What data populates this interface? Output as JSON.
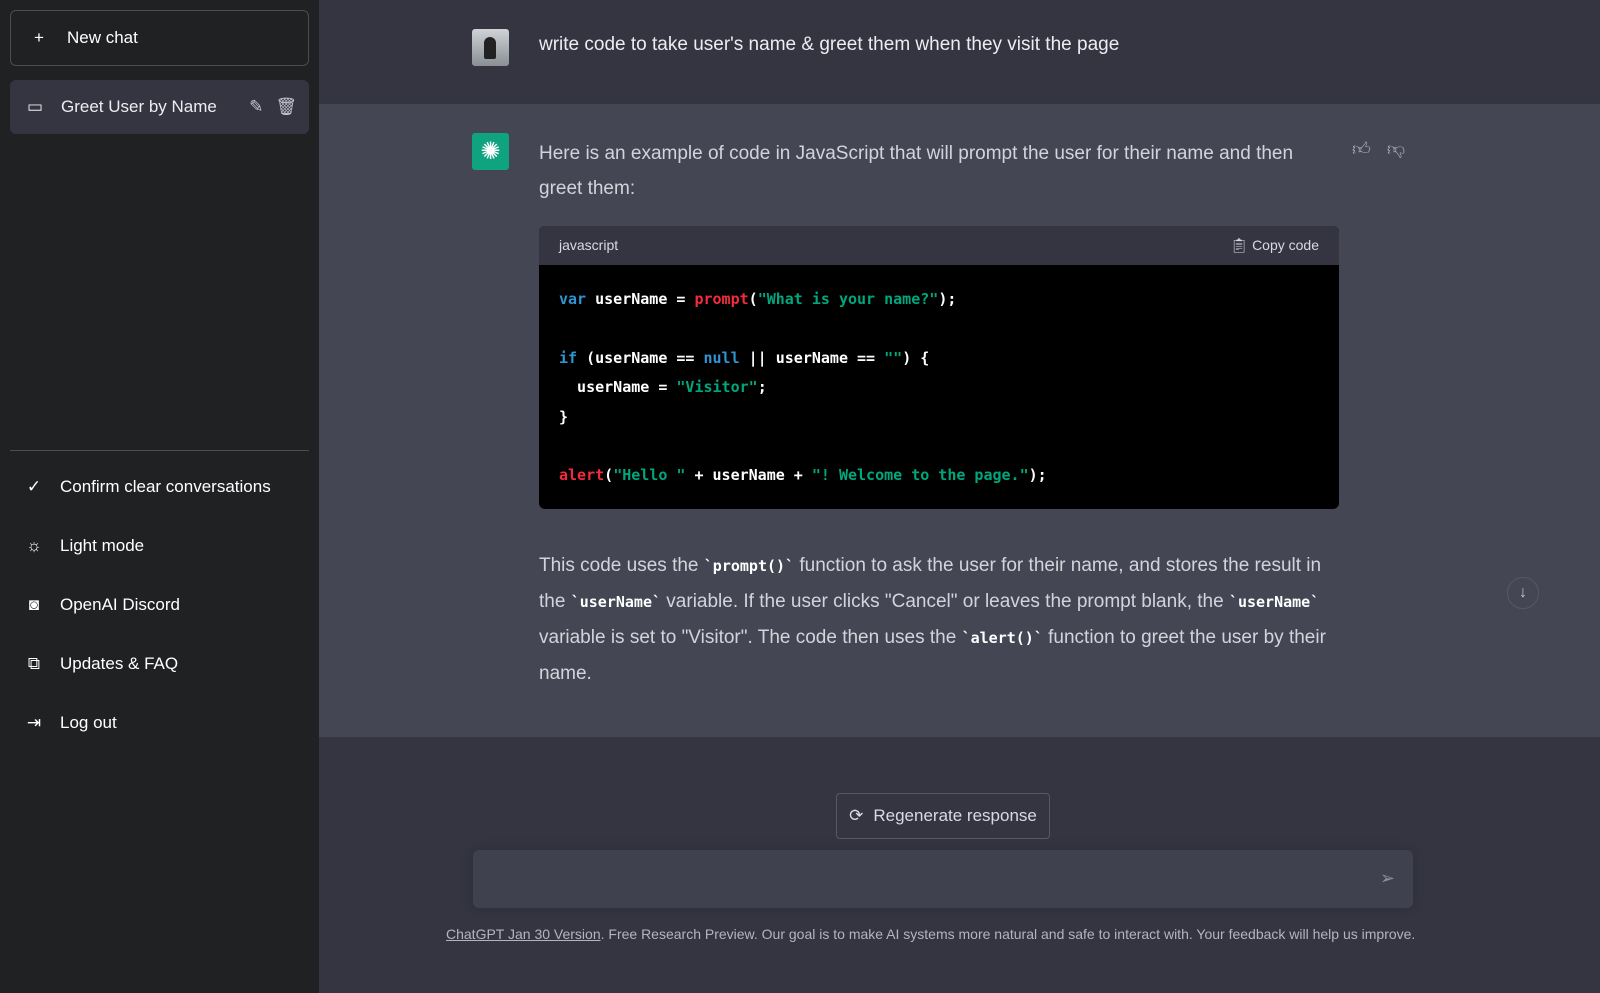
{
  "sidebar": {
    "new_chat": "New chat",
    "conversation": "Greet User by Name",
    "items": [
      {
        "label": "Confirm clear conversations",
        "icon": "check-icon"
      },
      {
        "label": "Light mode",
        "icon": "sun-icon"
      },
      {
        "label": "OpenAI Discord",
        "icon": "discord-icon"
      },
      {
        "label": "Updates & FAQ",
        "icon": "external-link-icon"
      },
      {
        "label": "Log out",
        "icon": "logout-icon"
      }
    ]
  },
  "chat": {
    "user_message": "write code to take user's name & greet them when they visit the page",
    "intro": "Here is an example of code in JavaScript that will prompt the user for their name and then greet them:",
    "code_lang": "javascript",
    "copy_label": "Copy code",
    "code_lines": [
      [
        [
          "kw",
          "var"
        ],
        [
          "p",
          " userName = "
        ],
        [
          "fn",
          "prompt"
        ],
        [
          "p",
          "("
        ],
        [
          "str",
          "\"What is your name?\""
        ],
        [
          "p",
          ");"
        ]
      ],
      [],
      [
        [
          "kw",
          "if"
        ],
        [
          "p",
          " (userName == "
        ],
        [
          "kw",
          "null"
        ],
        [
          "p",
          " || userName == "
        ],
        [
          "str",
          "\"\""
        ],
        [
          "p",
          ") {"
        ]
      ],
      [
        [
          "p",
          "  userName = "
        ],
        [
          "str",
          "\"Visitor\""
        ],
        [
          "p",
          ";"
        ]
      ],
      [
        [
          "p",
          "}"
        ]
      ],
      [],
      [
        [
          "fn",
          "alert"
        ],
        [
          "p",
          "("
        ],
        [
          "str",
          "\"Hello \""
        ],
        [
          "p",
          " + userName + "
        ],
        [
          "str",
          "\"! Welcome to the page.\""
        ],
        [
          "p",
          ");"
        ]
      ]
    ],
    "explain": {
      "t1": "This code uses the ",
      "c1": "`prompt()`",
      "t2": " function to ask the user for their name, and stores the result in the ",
      "c2": "`userName`",
      "t3": " variable. If the user clicks \"Cancel\" or leaves the prompt blank, the ",
      "c3": "`userName`",
      "t4": " variable is set to \"Visitor\". The code then uses the ",
      "c4": "`alert()`",
      "t5": " function to greet the user by their name."
    }
  },
  "regenerate": "Regenerate response",
  "footer": {
    "link": "ChatGPT Jan 30 Version",
    "text": ". Free Research Preview. Our goal is to make AI systems more natural and safe to interact with. Your feedback will help us improve."
  }
}
